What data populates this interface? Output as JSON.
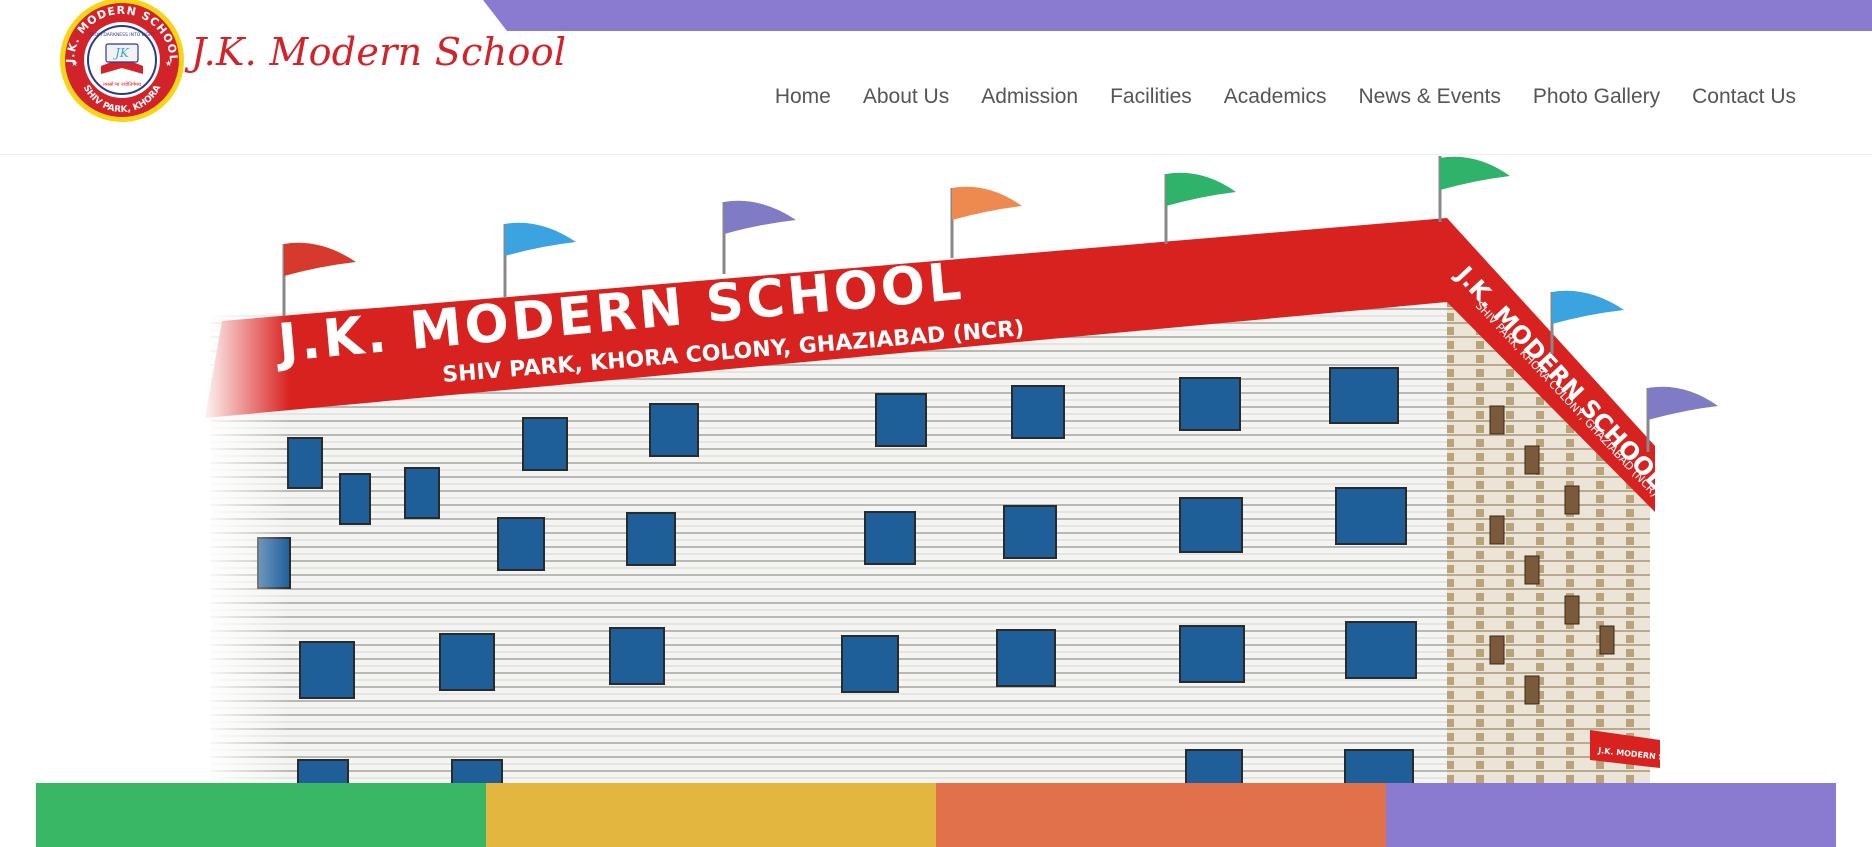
{
  "header": {
    "brand_name": "J.K. Modern School",
    "logo": {
      "ring_top_text": "J.K. MODERN SCHOOL",
      "ring_bottom_text": "SHIV PARK, KHORA",
      "motto_en": "FROM DARKNESS INTO LIGHT",
      "motto_hi": "तमसो मा ज्योतिर्गमय",
      "monogram": "JK"
    }
  },
  "nav": {
    "items": [
      {
        "label": "Home"
      },
      {
        "label": "About Us"
      },
      {
        "label": "Admission"
      },
      {
        "label": "Facilities"
      },
      {
        "label": "Academics"
      },
      {
        "label": "News & Events"
      },
      {
        "label": "Photo Gallery"
      },
      {
        "label": "Contact Us"
      }
    ]
  },
  "hero": {
    "banner_title": "J.K. MODERN SCHOOL",
    "banner_subtitle": "SHIV PARK, KHORA COLONY, GHAZIABAD (NCR)",
    "side_title": "J.K. MODERN SCHOOL",
    "side_subtitle": "SHIV PARK, KHORA COLONY, GHAZIABAD (NCR)",
    "gate_sign": "J.K. MODERN SCHOOL"
  },
  "colors": {
    "ribbon": "#8a7bd1",
    "brand_red": "#d2232a",
    "nav_text": "#555555",
    "tiles": [
      "#3ab764",
      "#e3b640",
      "#e1714a",
      "#8a7bd1"
    ],
    "flags": [
      "#d63a2c",
      "#3aa3e0",
      "#7f7bc4",
      "#ee8a4f",
      "#2fb36a",
      "#2fb36a",
      "#3aa3e0",
      "#7f7bc4"
    ]
  }
}
